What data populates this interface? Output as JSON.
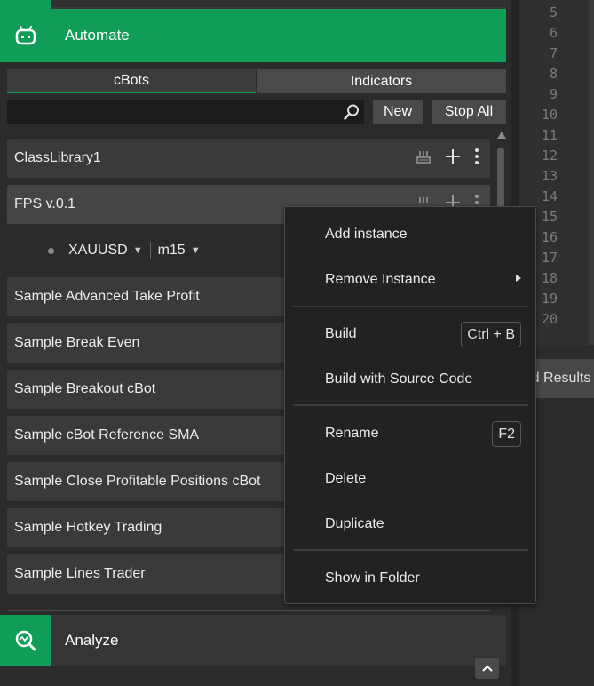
{
  "automate": {
    "title": "Automate"
  },
  "tabs": [
    {
      "label": "cBots"
    },
    {
      "label": "Indicators"
    }
  ],
  "search": {
    "placeholder": "",
    "value": ""
  },
  "toolbar": {
    "new_label": "New",
    "stop_all_label": "Stop All"
  },
  "cbots": {
    "items": [
      {
        "name": "ClassLibrary1"
      },
      {
        "name": "FPS v.0.1"
      },
      {
        "name": "Sample Advanced Take Profit"
      },
      {
        "name": "Sample Break Even"
      },
      {
        "name": "Sample Breakout cBot"
      },
      {
        "name": "Sample cBot Reference SMA"
      },
      {
        "name": "Sample Close Profitable Positions cBot"
      },
      {
        "name": "Sample Hotkey Trading"
      },
      {
        "name": "Sample Lines Trader"
      }
    ],
    "instance": {
      "symbol": "XAUUSD",
      "timeframe": "m15"
    }
  },
  "analyze": {
    "title": "Analyze"
  },
  "editor": {
    "line_numbers": [
      "5",
      "6",
      "7",
      "8",
      "9",
      "10",
      "11",
      "12",
      "13",
      "14",
      "15",
      "16",
      "17",
      "18",
      "19",
      "20"
    ]
  },
  "build_results": {
    "title": "Build Results"
  },
  "context_menu": {
    "items": [
      {
        "label": "Add instance"
      },
      {
        "label": "Remove Instance"
      },
      {
        "label": "Build",
        "shortcut": "Ctrl + B"
      },
      {
        "label": "Build with Source Code"
      },
      {
        "label": "Rename",
        "shortcut": "F2"
      },
      {
        "label": "Delete"
      },
      {
        "label": "Duplicate"
      },
      {
        "label": "Show in Folder"
      }
    ]
  },
  "colors": {
    "accent": "#0f9d58",
    "panel": "#2b2b2b",
    "row": "#3a3a3a",
    "menu": "#222222"
  }
}
